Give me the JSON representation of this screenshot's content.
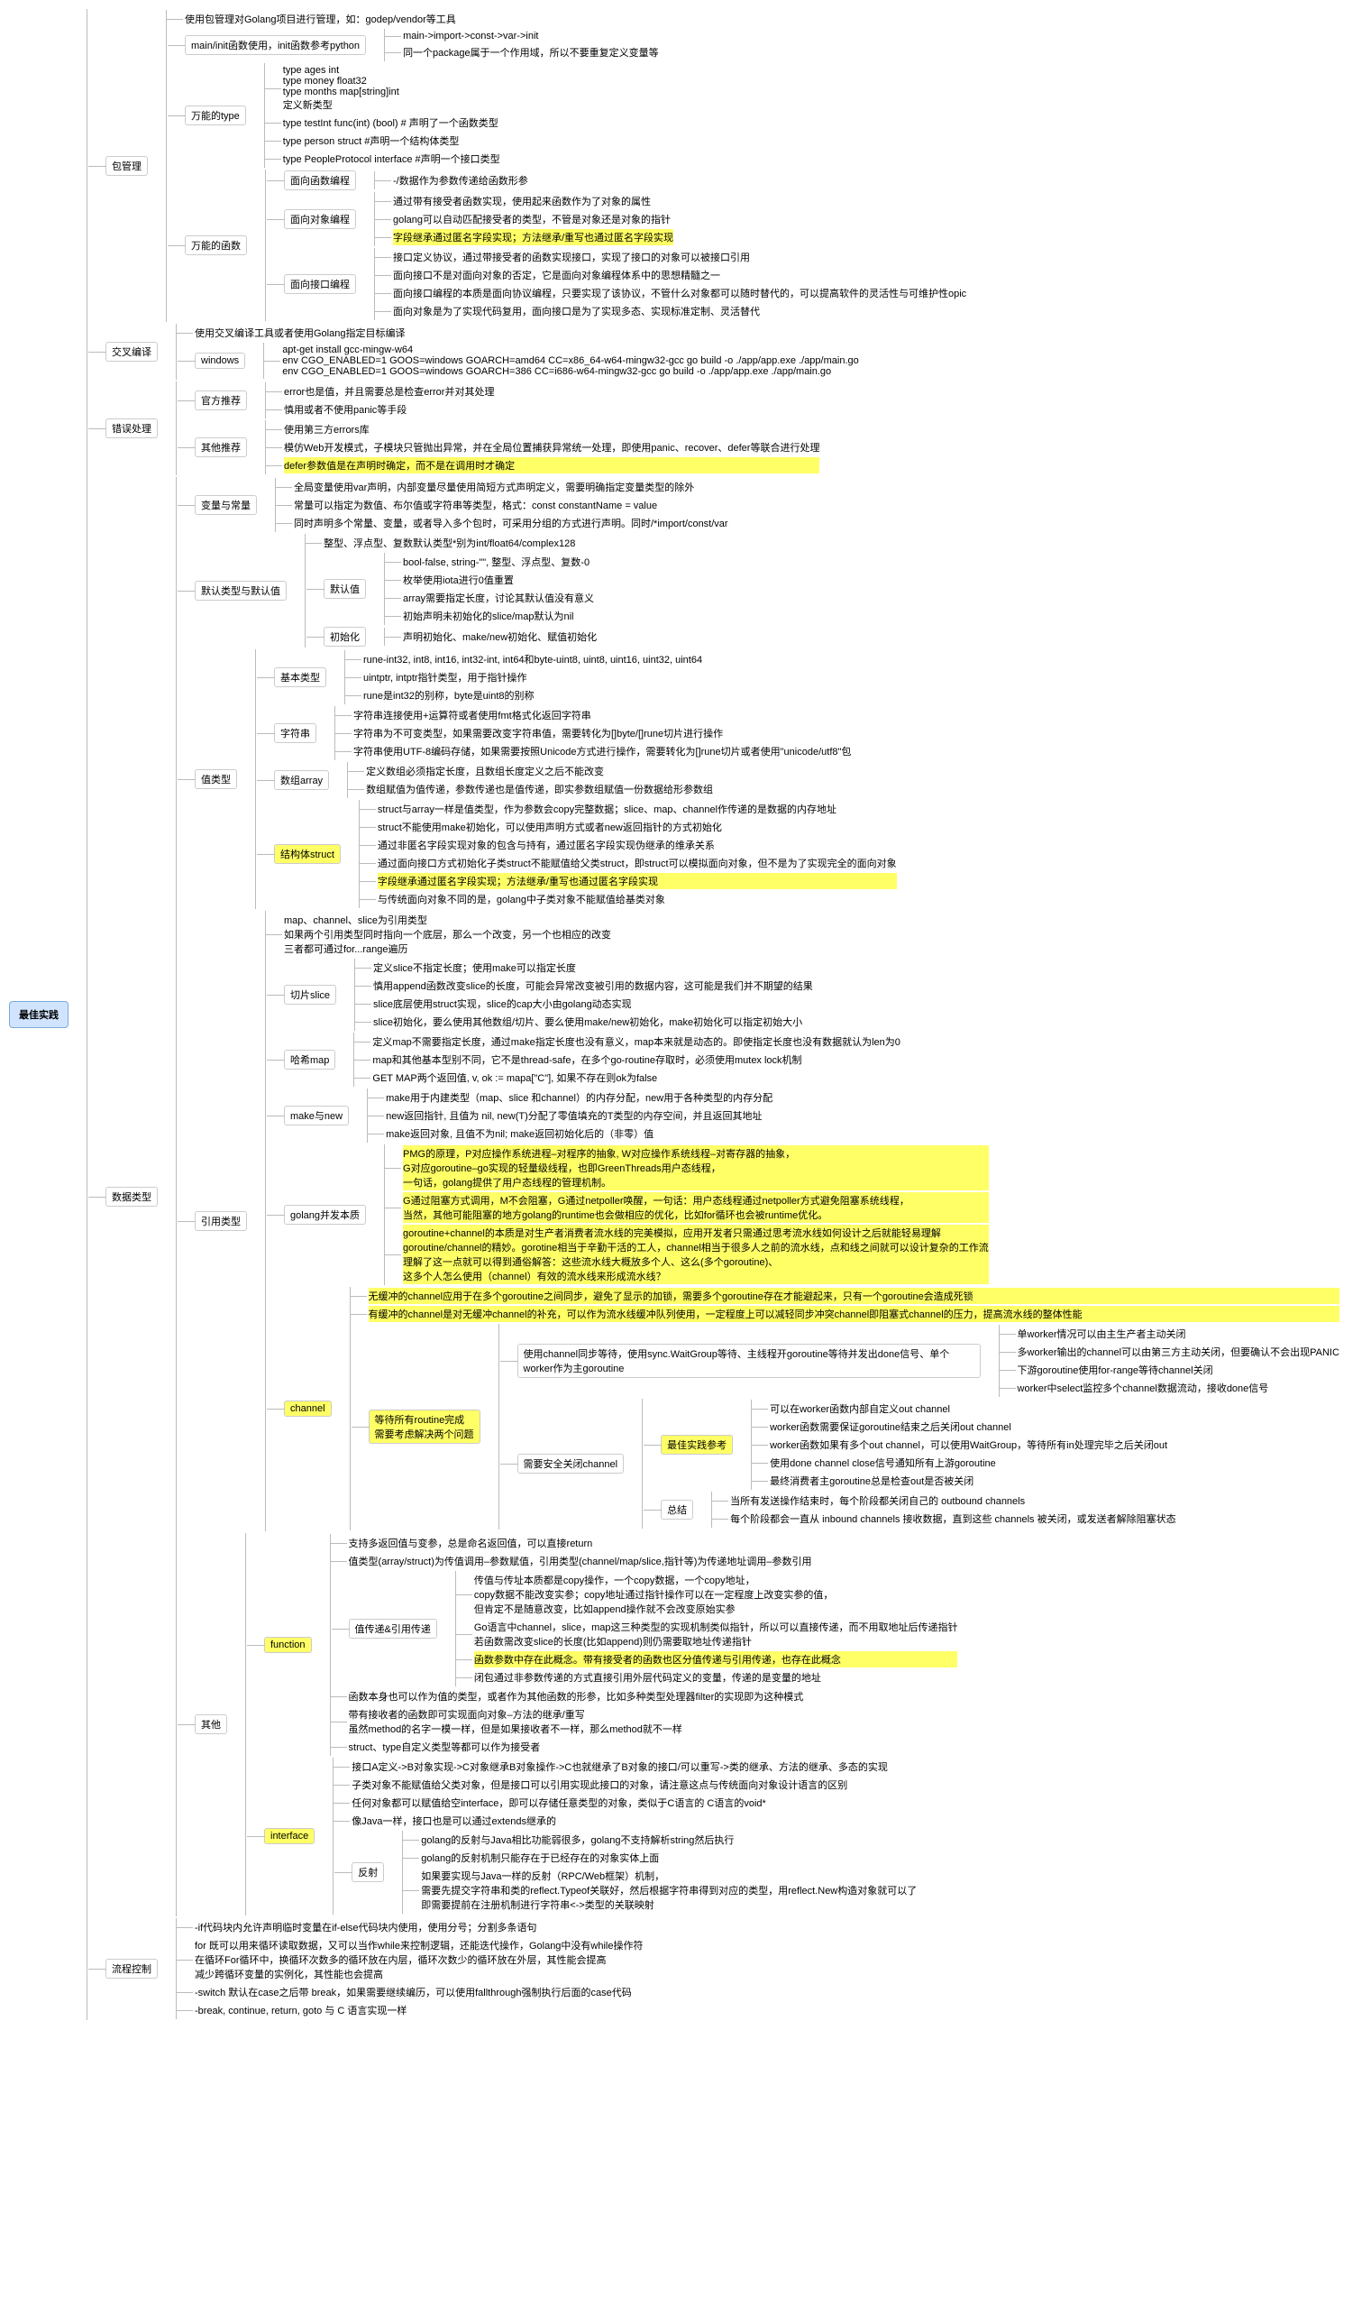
{
  "root": "最佳实践",
  "pkg": {
    "title": "包管理",
    "l1": "使用包管理对Golang项目进行管理，如：godep/vendor等工具",
    "main_init": "main/init函数使用，init函数参考python",
    "mi1": "main->import->const->var->init",
    "mi2": "同一个package属于一个作用域，所以不要重复定义变量等",
    "type_title": "万能的type",
    "t1": "type ages int",
    "t2": "type money float32",
    "t3": "type months map[string]int",
    "t4": "定义新类型",
    "t5": "type testInt func(int) (bool) # 声明了一个函数类型",
    "t6": "type person struct #声明一个结构体类型",
    "t7": "type PeopleProtocol interface #声明一个接口类型",
    "func_title": "万能的函数",
    "f_proc": "面向函数编程",
    "f_proc1": "-/数据作为参数传递给函数形参",
    "f_obj": "面向对象编程",
    "f_obj1": "通过带有接受者函数实现，使用起来函数作为了对象的属性",
    "f_obj2": "golang可以自动匹配接受者的类型，不管是对象还是对象的指针",
    "f_obj3": "字段继承通过匿名字段实现；方法继承/重写也通过匿名字段实现",
    "f_iface": "面向接口编程",
    "f_iface1": "接口定义协议，通过带接受者的函数实现接口，实现了接口的对象可以被接口引用",
    "f_iface2": "面向接口不是对面向对象的否定，它是面向对象编程体系中的思想精髓之一",
    "f_iface3": "面向接口编程的本质是面向协议编程，只要实现了该协议，不管什么对象都可以随时替代的，可以提高软件的灵活性与可维护性opic",
    "f_iface4": "面向对象是为了实现代码复用，面向接口是为了实现多态、实现标准定制、灵活替代"
  },
  "cross": {
    "title": "交叉编译",
    "l1": "使用交叉编译工具或者使用Golang指定目标编译",
    "windows": "windows",
    "w1": "apt-get install gcc-mingw-w64",
    "w2": "env CGO_ENABLED=1 GOOS=windows GOARCH=amd64 CC=x86_64-w64-mingw32-gcc go build -o ./app/app.exe ./app/main.go",
    "w3": "env CGO_ENABLED=1 GOOS=windows GOARCH=386 CC=i686-w64-mingw32-gcc go build -o ./app/app.exe ./app/main.go"
  },
  "err": {
    "title": "错误处理",
    "official": "官方推荐",
    "o1": "error也是值，并且需要总是检查error并对其处理",
    "o2": "慎用或者不使用panic等手段",
    "other": "其他推荐",
    "ot1": "使用第三方errors库",
    "ot2": "模仿Web开发模式，子模块只管抛出异常，并在全局位置捕获异常统一处理，即使用panic、recover、defer等联合进行处理",
    "ot3": "defer参数值是在声明时确定，而不是在调用时才确定"
  },
  "dtype": {
    "title": "数据类型",
    "var_const": "变量与常量",
    "vc1": "全局变量使用var声明，内部变量尽量使用简短方式声明定义，需要明确指定变量类型的除外",
    "vc2": "常量可以指定为数值、布尔值或字符串等类型，格式：const constantName = value",
    "vc3": "同时声明多个常量、变量，或者导入多个包时，可采用分组的方式进行声明。同时/*import/const/var",
    "def_type": "默认类型与默认值",
    "dt1": "整型、浮点型、复数默认类型*别为int/float64/complex128",
    "def_val": "默认值",
    "dv1": "bool-false, string-\"\", 整型、浮点型、复数-0",
    "dv2": "枚举使用iota进行0值重置",
    "dv3": "array需要指定长度，讨论其默认值没有意义",
    "dv4": "初始声明未初始化的slice/map默认为nil",
    "init": "初始化",
    "init1": "声明初始化、make/new初始化、赋值初始化",
    "val_type": "值类型",
    "basic": "基本类型",
    "b1": "rune-int32, int8, int16, int32-int, int64和byte-uint8, uint8, uint16, uint32, uint64",
    "b2": "uintptr, intptr指针类型，用于指针操作",
    "b3": "rune是int32的别称，byte是uint8的别称",
    "str": "字符串",
    "s1": "字符串连接使用+运算符或者使用fmt格式化返回字符串",
    "s2": "字符串为不可变类型，如果需要改变字符串值，需要转化为[]byte/[]rune切片进行操作",
    "s3": "字符串使用UTF-8编码存储，如果需要按照Unicode方式进行操作，需要转化为[]rune切片或者使用\"unicode/utf8\"包",
    "arr": "数组array",
    "a1": "定义数组必须指定长度，且数组长度定义之后不能改变",
    "a2": "数组赋值为值传递，参数传递也是值传递，即实参数组赋值一份数据给形参数组",
    "struct": "结构体struct",
    "st1": "struct与array一样是值类型，作为参数会copy完整数据；slice、map、channel作传递的是数据的内存地址",
    "st2": "struct不能使用make初始化，可以使用声明方式或者new返回指针的方式初始化",
    "st3": "通过非匿名字段实现对象的包含与持有，通过匿名字段实现伪继承的维承关系",
    "st4": "通过面向接口方式初始化子类struct不能赋值给父类struct，即struct可以模拟面向对象，但不是为了实现完全的面向对象",
    "st5": "字段继承通过匿名字段实现；方法继承/重写也通过匿名字段实现",
    "st6": "与传统面向对象不同的是，golang中子类对象不能赋值给基类对象",
    "ref_type": "引用类型",
    "ref1": "map、channel、slice为引用类型",
    "ref2": "如果两个引用类型同时指向一个底层，那么一个改变，另一个也相应的改变",
    "ref3": "三者都可通过for...range遍历",
    "slice": "切片slice",
    "sl1": "定义slice不指定长度；使用make可以指定长度",
    "sl2": "慎用append函数改变slice的长度，可能会异常改变被引用的数据内容，这可能是我们并不期望的结果",
    "sl3": "slice底层使用struct实现，slice的cap大小由golang动态实现",
    "sl4": "slice初始化，要么使用其他数组/切片、要么使用make/new初始化，make初始化可以指定初始大小",
    "map": "哈希map",
    "m1": "定义map不需要指定长度，通过make指定长度也没有意义，map本来就是动态的。即使指定长度也没有数据就认为len为0",
    "m2": "map和其他基本型别不同，它不是thread-safe，在多个go-routine存取时，必须使用mutex lock机制",
    "m3": "GET MAP两个返回值, v, ok := mapa[\"C\"], 如果不存在则ok为false",
    "mn": "make与new",
    "mn1": "make用于内建类型（map、slice 和channel）的内存分配，new用于各种类型的内存分配",
    "mn2": "new返回指针, 且值为 nil, new(T)分配了零值填充的T类型的内存空间，并且返回其地址",
    "mn3": "make返回对象, 且值不为nil; make返回初始化后的（非零）值",
    "go_nature": "golang并发本质",
    "gn1": "PMG的原理，P对应操作系统进程–对程序的抽象, W对应操作系统线程–对寄存器的抽象，",
    "gn2": "G对应goroutine–go实现的轻量级线程，也即GreenThreads用户态线程，",
    "gn3": "一句话，golang提供了用户态线程的管理机制。",
    "gn4": "G通过阻塞方式调用，M不会阻塞，G通过netpoller唤醒，一句话：用户态线程通过netpoller方式避免阻塞系统线程，",
    "gn5": "当然，其他可能阻塞的地方golang的runtime也会做相应的优化，比如for循环也会被runtime优化。",
    "gn6": "goroutine+channel的本质是对生产者消费者流水线的完美模拟，应用开发者只需通过思考流水线如何设计之后就能轻易理解",
    "gn7": "goroutine/channel的精妙。gorotine相当于辛勤干活的工人，channel相当于很多人之前的流水线，点和线之间就可以设计复杂的工作流",
    "gn8": "理解了这一点就可以得到通俗解答：这些流水线大概放多个人、这么(多个goroutine)、",
    "gn9": "这多个人怎么使用（channel）有效的流水线来形成流水线？",
    "chan": "channel",
    "ch1": "无缓冲的channel应用于在多个goroutine之间同步，避免了显示的加锁，需要多个goroutine存在才能避起来，只有一个goroutine会造成死锁",
    "ch2": "有缓冲的channel是对无缓冲channel的补充，可以作为流水线缓冲队列使用，一定程度上可以减轻同步冲突channel即阻塞式channel的压力，提高流水线的整体性能",
    "wait": "等待所有routine完成\n需要考虑解决两个问题",
    "sync": "使用channel同步等待，使用sync.WaitGroup等待、主线程开goroutine等待并发出done信号、单个worker作为主goroutine",
    "close": "需要安全关闭channel",
    "sy1": "单worker情况可以由主生产者主动关闭",
    "sy2": "多worker输出的channel可以由第三方主动关闭，但要确认不会出现PANIC",
    "sy3": "下游goroutine使用for-range等待channel关闭",
    "sy4": "worker中select监控多个channel数据流动，接收done信号",
    "best": "最佳实践参考",
    "bp1": "可以在worker函数内部自定义out channel",
    "bp2": "worker函数需要保证goroutine结束之后关闭out channel",
    "bp3": "worker函数如果有多个out channel，可以使用WaitGroup，等待所有in处理完毕之后关闭out",
    "bp4": "使用done channel close信号通知所有上游goroutine",
    "bp5": "最终消费者主goroutine总是检查out是否被关闭",
    "sum": "总结",
    "sum1": "当所有发送操作结束时，每个阶段都关闭自己的 outbound channels",
    "sum2": "每个阶段都会一直从 inbound channels 接收数据，直到这些 channels 被关闭，或发送者解除阻塞状态",
    "other": "其他",
    "func": "function",
    "fn1": "支持多返回值与变参，总是命名返回值，可以直接return",
    "fn2": "值类型(array/struct)为传值调用–参数赋值，引用类型(channel/map/slice,指针等)为传递地址调用–参数引用",
    "fn_pass": "值传递&引用传递",
    "fp1": "传值与传址本质都是copy操作，一个copy数据，一个copy地址，",
    "fp2": "copy数据不能改变实参；copy地址通过指针操作可以在一定程度上改变实参的值，",
    "fp3": "但肯定不是随意改变，比如append操作就不会改变原始实参",
    "fp4": "Go语言中channel，slice，map这三种类型的实现机制类似指针，所以可以直接传递，而不用取地址后传递指针",
    "fp5": "若函数需改变slice的长度(比如append)则仍需要取地址传递指针",
    "fp6": "函数参数中存在此概念。带有接受者的函数也区分值传递与引用传递，也存在此概念",
    "fp7": "闭包通过非参数传递的方式直接引用外层代码定义的变量，传递的是变量的地址",
    "fn3": "函数本身也可以作为值的类型，或者作为其他函数的形参，比如多种类型处理器filter的实现即为这种模式",
    "fn4": "带有接收者的函数即可实现面向对象–方法的继承/重写",
    "fn5": "虽然method的名字一模一样，但是如果接收者不一样，那么method就不一样",
    "fn6": "struct、type自定义类型等都可以作为接受者",
    "iface": "interface",
    "if1": "接口A定义->B对象实现->C对象继承B对象操作->C也就继承了B对象的接口/可以重写->类的继承、方法的继承、多态的实现",
    "if2": "子类对象不能赋值给父类对象，但是接口可以引用实现此接口的对象，请注意这点与传统面向对象设计语言的区别",
    "if3": "任何对象都可以赋值给空interface，即可以存储任意类型的对象，类似于C语言的 C语言的void*",
    "if4": "像Java一样，接口也是可以通过extends继承的",
    "refl": "反射",
    "rf1": "golang的反射与Java相比功能弱很多，golang不支持解析string然后执行",
    "rf2": "golang的反射机制只能存在于已经存在的对象实体上面",
    "rf3": "如果要实现与Java一样的反射（RPC/Web框架）机制，",
    "rf4": "需要先提交字符串和类的reflect.Typeof关联好，然后根据字符串得到对应的类型，用reflect.New构造对象就可以了",
    "rf5": "即需要提前在注册机制进行字符串<->类型的关联映射"
  },
  "flow": {
    "title": "流程控制",
    "f1": "-if代码块内允许声明临时变量在if-else代码块内使用，使用分号；分割多条语句",
    "f2": "for 既可以用来循环读取数据，又可以当作while来控制逻辑，还能迭代操作，Golang中没有while操作符\n在循环For循环中，换循环次数多的循环放在内层，循环次数少的循环放在外层，其性能会提高\n减少跨循环变量的实例化，其性能也会提高",
    "f3": "-switch 默认在case之后带 break，如果需要继续编历，可以使用fallthrough强制执行后面的case代码",
    "f4": "-break, continue, return, goto 与 C 语言实现一样"
  }
}
